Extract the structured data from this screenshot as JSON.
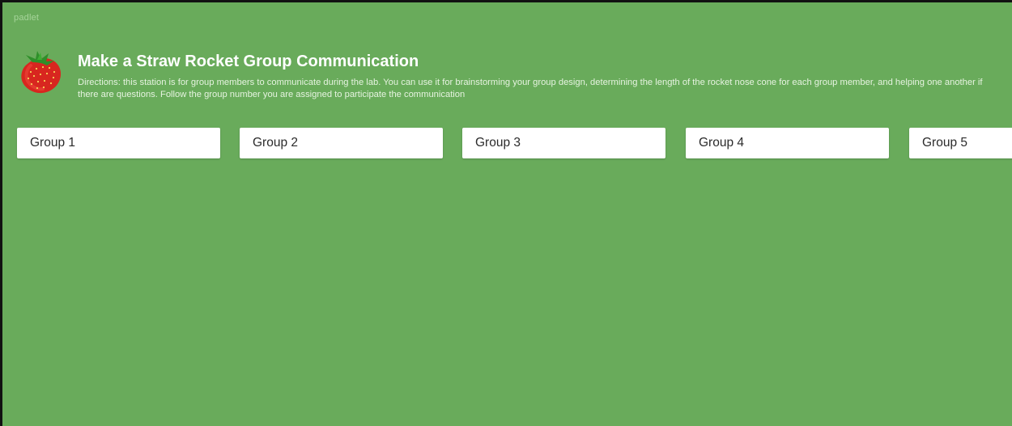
{
  "app": {
    "brand": "padlet"
  },
  "header": {
    "logo_icon": "strawberry-icon",
    "title": "Make a Straw Rocket Group Communication",
    "description": "Directions: this station is for group members to communicate during the lab. You can use it for brainstorming your group design, determining the length of the rocket nose cone for each group member, and helping one another if there are questions. Follow the group number you are assigned to participate the communication"
  },
  "columns": [
    {
      "label": "Group 1"
    },
    {
      "label": "Group 2"
    },
    {
      "label": "Group 3"
    },
    {
      "label": "Group 4"
    },
    {
      "label": "Group 5"
    }
  ],
  "colors": {
    "background": "#69ab5b",
    "column_header_bg": "#ffffff",
    "title_text": "#ffffff"
  }
}
